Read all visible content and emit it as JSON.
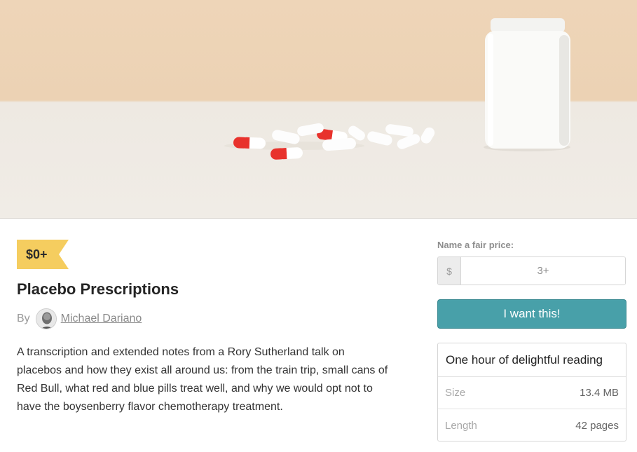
{
  "product": {
    "price_tag": "$0+",
    "title": "Placebo Prescriptions",
    "by_label": "By",
    "author": "Michael Dariano",
    "description": "A transcription and extended notes from a Rory Sutherland talk on placebos and how they exist all around us: from the train trip, small cans of Red Bull, what red and blue pills treat well, and why we would opt not to have the boysenberry flavor chemotherapy treatment."
  },
  "purchase": {
    "price_label": "Name a fair price:",
    "currency": "$",
    "price_placeholder": "3+",
    "buy_label": "I want this!",
    "summary": "One hour of delightful reading",
    "details": [
      {
        "key": "Size",
        "value": "13.4 MB"
      },
      {
        "key": "Length",
        "value": "42 pages"
      }
    ]
  },
  "colors": {
    "accent": "#48a0a9",
    "price_tag": "#f5cd5f"
  }
}
